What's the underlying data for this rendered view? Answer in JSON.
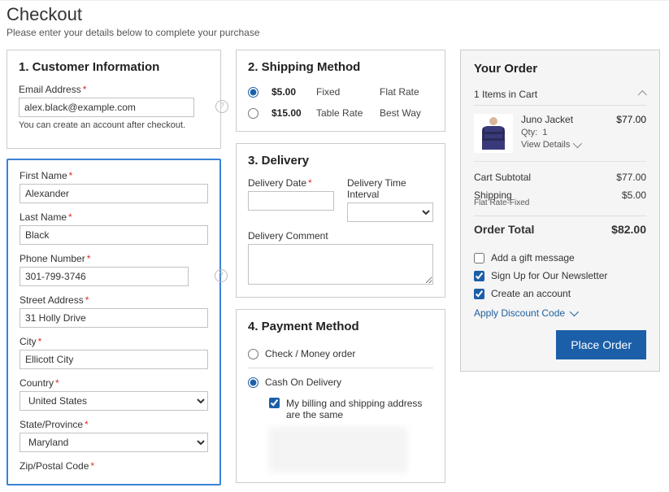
{
  "header": {
    "title": "Checkout",
    "subtitle": "Please enter your details below to complete your purchase"
  },
  "customer": {
    "heading": "1. Customer Information",
    "email_label": "Email Address",
    "email_value": "alex.black@example.com",
    "email_hint": "You can create an account after checkout.",
    "first_name_label": "First Name",
    "first_name_value": "Alexander",
    "last_name_label": "Last Name",
    "last_name_value": "Black",
    "phone_label": "Phone Number",
    "phone_value": "301-799-3746",
    "street_label": "Street Address",
    "street_value": "31 Holly Drive",
    "city_label": "City",
    "city_value": "Ellicott City",
    "country_label": "Country",
    "country_value": "United States",
    "state_label": "State/Province",
    "state_value": "Maryland",
    "zip_label": "Zip/Postal Code"
  },
  "shipping": {
    "heading": "2. Shipping Method",
    "methods": [
      {
        "price": "$5.00",
        "type": "Fixed",
        "name": "Flat Rate",
        "selected": true
      },
      {
        "price": "$15.00",
        "type": "Table Rate",
        "name": "Best Way",
        "selected": false
      }
    ]
  },
  "delivery": {
    "heading": "3. Delivery",
    "date_label": "Delivery Date",
    "time_label": "Delivery Time Interval",
    "comment_label": "Delivery Comment"
  },
  "payment": {
    "heading": "4. Payment Method",
    "check_label": "Check / Money order",
    "cod_label": "Cash On Delivery",
    "same_addr_label": "My billing and shipping address are the same"
  },
  "order": {
    "heading": "Your Order",
    "cart_count_label": "1 Items in Cart",
    "items": [
      {
        "name": "Juno Jacket",
        "qty_label": "Qty:",
        "qty": "1",
        "view": "View Details",
        "price": "$77.00"
      }
    ],
    "subtotal_label": "Cart Subtotal",
    "subtotal_value": "$77.00",
    "shipping_label": "Shipping",
    "shipping_sub": "Flat Rate-Fixed",
    "shipping_value": "$5.00",
    "total_label": "Order Total",
    "total_value": "$82.00",
    "gift_label": "Add a gift message",
    "newsletter_label": "Sign Up for Our Newsletter",
    "create_acct_label": "Create an account",
    "discount_label": "Apply Discount Code",
    "place_order_label": "Place Order"
  }
}
